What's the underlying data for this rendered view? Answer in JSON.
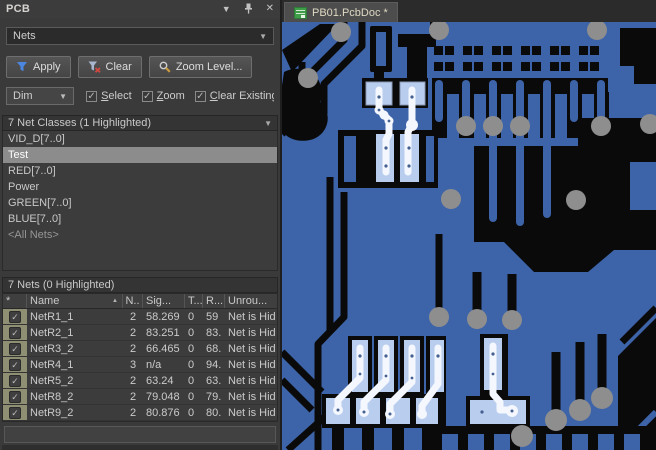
{
  "panel": {
    "title": "PCB",
    "net_type_dropdown": "Nets",
    "apply_button": "Apply",
    "clear_button": "Clear",
    "zoom_level_button": "Zoom Level...",
    "dim_dropdown": "Dim",
    "checkboxes": [
      {
        "label": "Select",
        "checked": true
      },
      {
        "label": "Zoom",
        "checked": true
      },
      {
        "label": "Clear Existing",
        "checked": true
      }
    ],
    "classes_header": "7 Net Classes (1 Highlighted)",
    "classes": [
      {
        "label": "VID_D[7..0]"
      },
      {
        "label": "Test",
        "selected": true
      },
      {
        "label": "RED[7..0]"
      },
      {
        "label": "Power"
      },
      {
        "label": "GREEN[7..0]"
      },
      {
        "label": "BLUE[7..0]"
      },
      {
        "label": "<All Nets>",
        "muted": true
      }
    ],
    "nets_header": "7 Nets (0 Highlighted)",
    "table": {
      "columns": [
        "*",
        "Name",
        "N..",
        "Sig...",
        "T...",
        "R...",
        "Unrou..."
      ],
      "sort_column": "Name",
      "rows": [
        {
          "checked": true,
          "name": "NetR1_1",
          "nodes": "2",
          "signal": "58.269",
          "t": "0",
          "r": "59",
          "unrouted": "Net is Hid"
        },
        {
          "checked": true,
          "name": "NetR2_1",
          "nodes": "2",
          "signal": "83.251",
          "t": "0",
          "r": "83.",
          "unrouted": "Net is Hid"
        },
        {
          "checked": true,
          "name": "NetR3_2",
          "nodes": "2",
          "signal": "66.465",
          "t": "0",
          "r": "68.",
          "unrouted": "Net is Hid"
        },
        {
          "checked": true,
          "name": "NetR4_1",
          "nodes": "3",
          "signal": "n/a",
          "t": "0",
          "r": "94.",
          "unrouted": "Net is Hid"
        },
        {
          "checked": true,
          "name": "NetR5_2",
          "nodes": "2",
          "signal": "63.24",
          "t": "0",
          "r": "63.",
          "unrouted": "Net is Hid"
        },
        {
          "checked": true,
          "name": "NetR8_2",
          "nodes": "2",
          "signal": "79.048",
          "t": "0",
          "r": "79.",
          "unrouted": "Net is Hid"
        },
        {
          "checked": true,
          "name": "NetR9_2",
          "nodes": "2",
          "signal": "80.876",
          "t": "0",
          "r": "80.",
          "unrouted": "Net is Hid"
        }
      ]
    }
  },
  "document_tab": {
    "label": "PB01.PcbDoc *"
  },
  "colors": {
    "panel_bg": "#3a3a3a",
    "text": "#cccccc",
    "selected_row_bg": "#8c8c8c",
    "check_cell_bg": "#8f8f73",
    "pcb_blue": "#3d63a8",
    "pcb_black": "#0a0a0a",
    "via_gray": "#8e8e8e",
    "pad_light_blue": "#b9cdef",
    "highlight_white": "#f4f7fe",
    "apply_funnel_blue": "#4b86e0",
    "clear_x_red": "#d04840",
    "tab_icon_green": "#3f9c49"
  }
}
